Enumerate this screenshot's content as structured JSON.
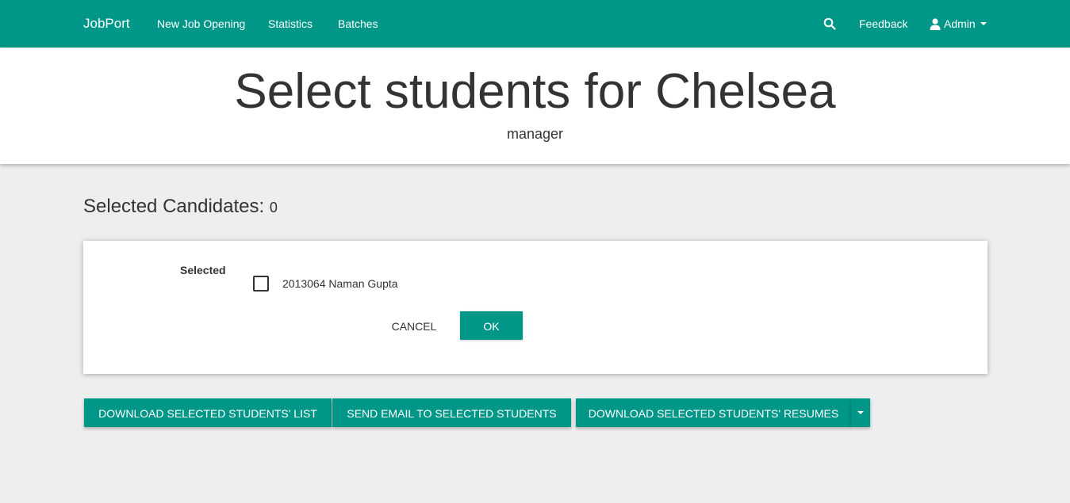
{
  "navbar": {
    "brand": "JobPort",
    "links": [
      "New Job Opening",
      "Statistics",
      "Batches"
    ],
    "search_icon": "search-icon",
    "feedback": "Feedback",
    "user_icon": "user-icon",
    "admin": "Admin",
    "bg_color": "#009688"
  },
  "header": {
    "title": "Select students for Chelsea",
    "subtitle": "manager"
  },
  "selected": {
    "label": "Selected Candidates:",
    "count": "0"
  },
  "card": {
    "label": "Selected",
    "checkbox": {
      "label": "2013064 Naman Gupta",
      "checked": false
    },
    "cancel_label": "CANCEL",
    "ok_label": "OK"
  },
  "actions": {
    "download_list": "DOWNLOAD SELECTED STUDENTS' LIST",
    "send_email": "SEND EMAIL TO SELECTED STUDENTS",
    "download_resumes": "DOWNLOAD SELECTED STUDENTS' RESUMES"
  },
  "colors": {
    "accent": "#009688",
    "background": "#eeeeee"
  }
}
